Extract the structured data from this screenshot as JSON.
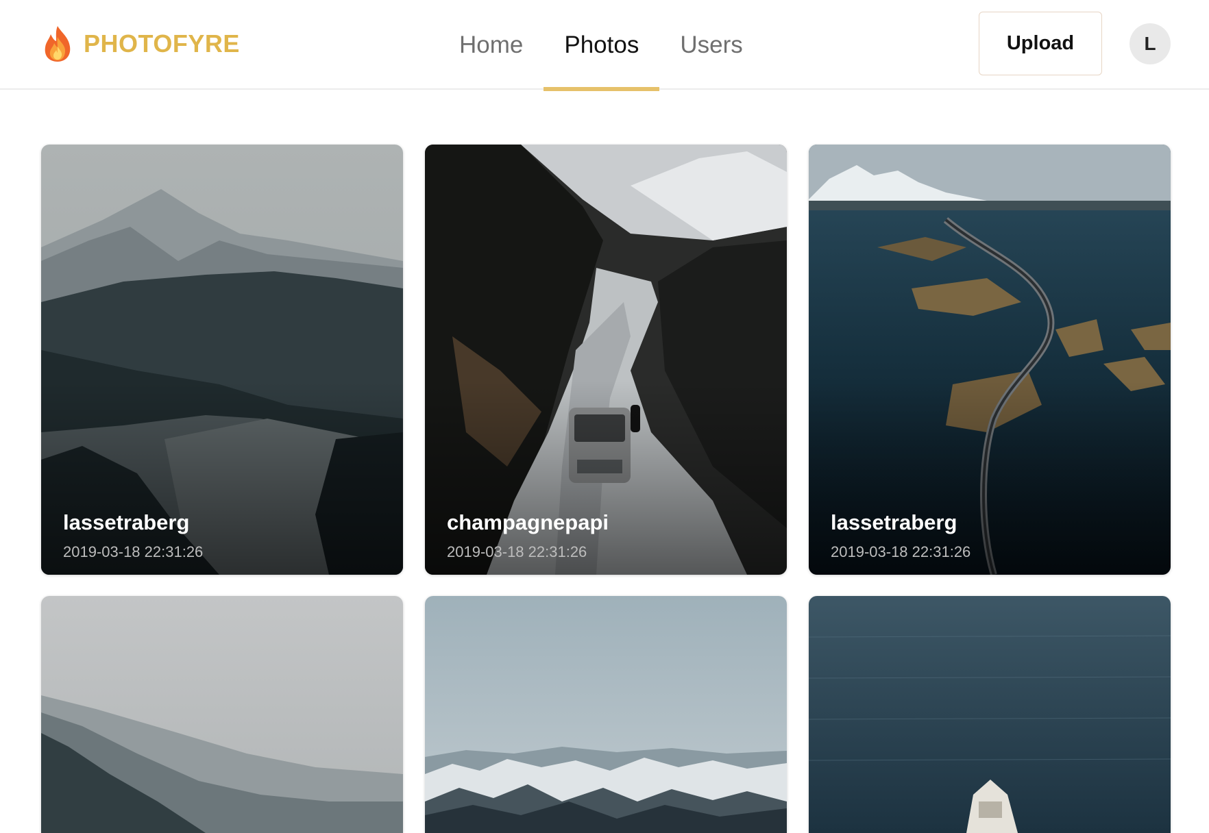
{
  "brand": {
    "name": "PHOTOFYRE",
    "logo_icon": "flame-icon",
    "color": "#e0b54a"
  },
  "nav": {
    "items": [
      {
        "label": "Home",
        "active": false
      },
      {
        "label": "Photos",
        "active": true
      },
      {
        "label": "Users",
        "active": false
      }
    ],
    "active_color": "#e6c16a"
  },
  "header": {
    "upload_label": "Upload",
    "avatar_initial": "L"
  },
  "photos": [
    {
      "author": "lassetraberg",
      "date": "2019-03-18 22:31:26",
      "scene": "misty forested mountain valley"
    },
    {
      "author": "champagnepapi",
      "date": "2019-03-18 22:31:26",
      "scene": "car on snowy mountain road"
    },
    {
      "author": "lassetraberg",
      "date": "2019-03-18 22:31:26",
      "scene": "aerial coastal road over islands"
    },
    {
      "scene": "foggy mountain ridges"
    },
    {
      "scene": "snowy mountain range under pale sky"
    },
    {
      "scene": "boat on open dark sea"
    }
  ]
}
